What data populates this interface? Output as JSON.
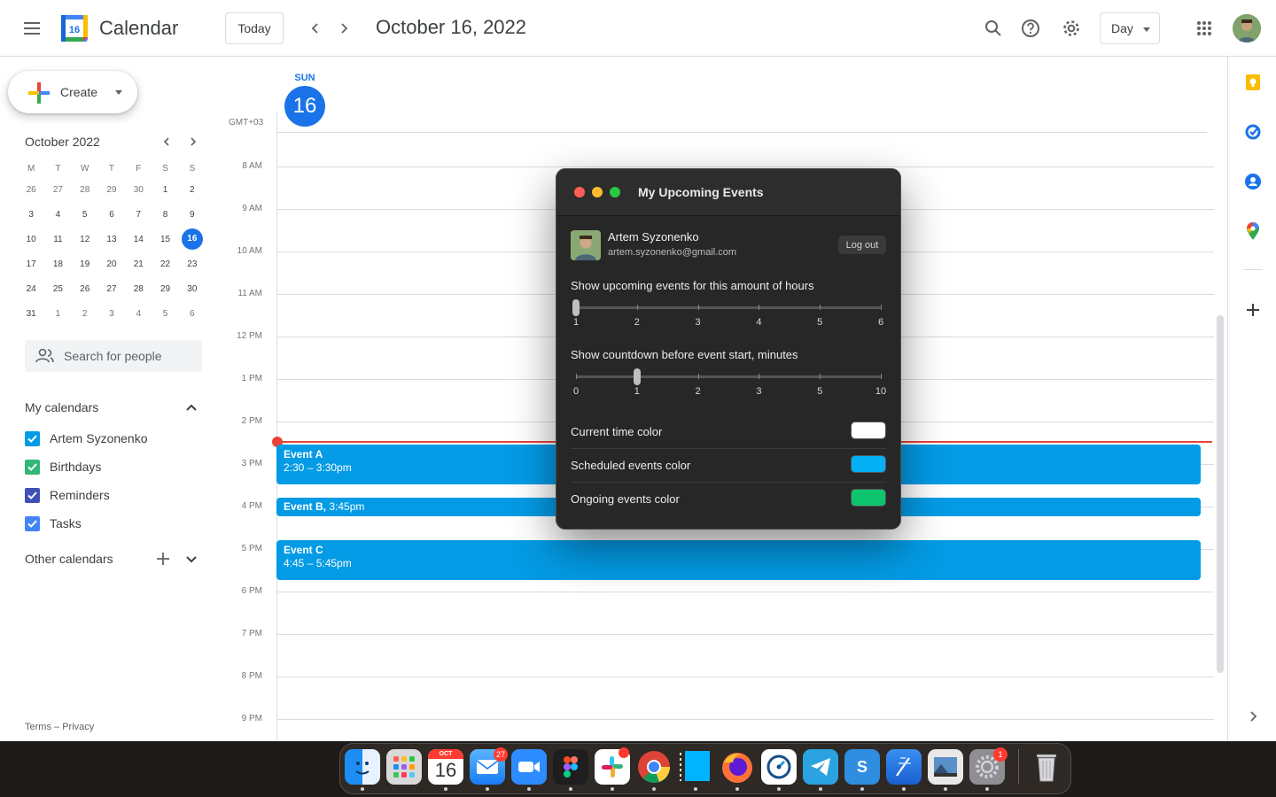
{
  "header": {
    "app_title": "Calendar",
    "logo_day": "16",
    "today_label": "Today",
    "date_title": "October 16, 2022",
    "view": "Day"
  },
  "sidebar": {
    "create_label": "Create",
    "mini_cal": {
      "title": "October 2022",
      "weekdays": [
        "M",
        "T",
        "W",
        "T",
        "F",
        "S",
        "S"
      ],
      "weeks": [
        [
          "26",
          "27",
          "28",
          "29",
          "30",
          "1",
          "2"
        ],
        [
          "3",
          "4",
          "5",
          "6",
          "7",
          "8",
          "9"
        ],
        [
          "10",
          "11",
          "12",
          "13",
          "14",
          "15",
          "16"
        ],
        [
          "17",
          "18",
          "19",
          "20",
          "21",
          "22",
          "23"
        ],
        [
          "24",
          "25",
          "26",
          "27",
          "28",
          "29",
          "30"
        ],
        [
          "31",
          "1",
          "2",
          "3",
          "4",
          "5",
          "6"
        ]
      ],
      "selected": "16"
    },
    "search_people": "Search for people",
    "my_calendars_title": "My calendars",
    "my_calendars": [
      {
        "name": "Artem Syzonenko",
        "color": "#039be5"
      },
      {
        "name": "Birthdays",
        "color": "#33b679"
      },
      {
        "name": "Reminders",
        "color": "#3f51b5"
      },
      {
        "name": "Tasks",
        "color": "#4285f4"
      }
    ],
    "other_calendars_title": "Other calendars",
    "footer_terms": "Terms",
    "footer_sep": "–",
    "footer_privacy": "Privacy"
  },
  "day_view": {
    "weekday": "SUN",
    "day": "16",
    "timezone": "GMT+03",
    "hours": [
      "8 AM",
      "9 AM",
      "10 AM",
      "11 AM",
      "12 PM",
      "1 PM",
      "2 PM",
      "3 PM",
      "4 PM",
      "5 PM",
      "6 PM",
      "7 PM",
      "8 PM",
      "9 PM"
    ],
    "events": [
      {
        "title": "Event A",
        "time": "2:30 – 3:30pm"
      },
      {
        "title": "Event B,",
        "time": "3:45pm"
      },
      {
        "title": "Event C",
        "time": "4:45 – 5:45pm"
      }
    ]
  },
  "popup": {
    "title": "My Upcoming Events",
    "user_name": "Artem Syzonenko",
    "user_email": "artem.syzonenko@gmail.com",
    "logout_label": "Log out",
    "hours_label": "Show upcoming events for this amount of hours",
    "hours_ticks": [
      "1",
      "2",
      "3",
      "4",
      "5",
      "6"
    ],
    "hours_value": "1",
    "countdown_label": "Show countdown before event start, minutes",
    "countdown_ticks": [
      "0",
      "1",
      "2",
      "3",
      "5",
      "10"
    ],
    "countdown_value": "1",
    "colors": [
      {
        "label": "Current time color",
        "color": "#ffffff"
      },
      {
        "label": "Scheduled events color",
        "color": "#03b0f5"
      },
      {
        "label": "Ongoing events color",
        "color": "#0fc46e"
      }
    ]
  },
  "dock": {
    "calendar_month": "OCT",
    "calendar_day": "16",
    "mail_badge": "27",
    "settings_badge": "1"
  }
}
